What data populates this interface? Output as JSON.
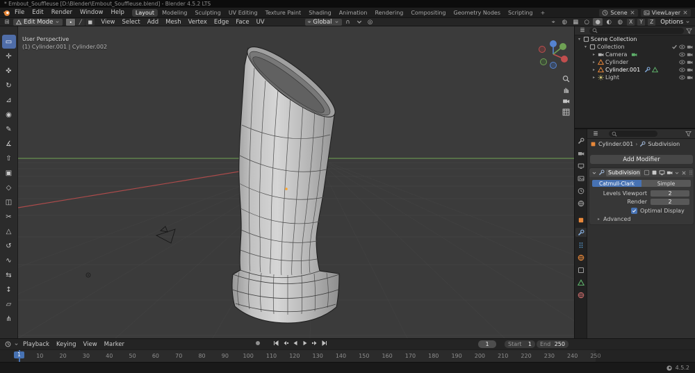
{
  "colors": {
    "accent": "#4772b3",
    "object_orange": "#e8883a",
    "data_green": "#5eb06a",
    "axis_green": "#6fa154",
    "axis_red": "#c14e4e"
  },
  "titlebar": {
    "title": "* Embout_Souffleuse [D:\\Blender\\Embout_Souffleuse.blend] - Blender 4.5.2 LTS"
  },
  "topbar": {
    "menus": [
      "File",
      "Edit",
      "Render",
      "Window",
      "Help"
    ],
    "workspaces": [
      "Layout",
      "Modeling",
      "Sculpting",
      "UV Editing",
      "Texture Paint",
      "Shading",
      "Animation",
      "Rendering",
      "Compositing",
      "Geometry Nodes",
      "Scripting"
    ],
    "add_workspace": "+",
    "scene": "Scene",
    "viewlayer": "ViewLayer"
  },
  "tool_header": {
    "mode": "Edit Mode",
    "menus": [
      "View",
      "Select",
      "Add",
      "Mesh",
      "Vertex",
      "Edge",
      "Face",
      "UV"
    ],
    "orientation": "Global",
    "mirror_axes": [
      "X",
      "Y",
      "Z"
    ],
    "options": "Options"
  },
  "toolbar": {
    "tools": [
      {
        "name": "select-box",
        "glyph": "▭"
      },
      {
        "name": "cursor",
        "glyph": "✛"
      },
      {
        "name": "move",
        "glyph": "✜"
      },
      {
        "name": "rotate",
        "glyph": "↻"
      },
      {
        "name": "scale",
        "glyph": "⊿"
      },
      {
        "name": "transform",
        "glyph": "◉"
      },
      {
        "name": "annotate",
        "glyph": "✎"
      },
      {
        "name": "measure",
        "glyph": "∡"
      },
      {
        "name": "extrude-region",
        "glyph": "⇧"
      },
      {
        "name": "inset-faces",
        "glyph": "▣"
      },
      {
        "name": "bevel",
        "glyph": "◇"
      },
      {
        "name": "loop-cut",
        "glyph": "◫"
      },
      {
        "name": "knife",
        "glyph": "✂"
      },
      {
        "name": "poly-build",
        "glyph": "△"
      },
      {
        "name": "spin",
        "glyph": "↺"
      },
      {
        "name": "smooth",
        "glyph": "∿"
      },
      {
        "name": "edge-slide",
        "glyph": "⇆"
      },
      {
        "name": "shrink-flatten",
        "glyph": "↕"
      },
      {
        "name": "shear",
        "glyph": "▱"
      },
      {
        "name": "rip-region",
        "glyph": "⋔"
      }
    ]
  },
  "viewport": {
    "overlay_line1": "User Perspective",
    "overlay_line2": "(1) Cylinder.001 | Cylinder.002"
  },
  "outliner": {
    "rows": [
      {
        "label": "Scene Collection"
      },
      {
        "label": "Collection"
      },
      {
        "label": "Camera"
      },
      {
        "label": "Cylinder"
      },
      {
        "label": "Cylinder.001"
      },
      {
        "label": "Light"
      }
    ]
  },
  "properties": {
    "breadcrumb_object": "Cylinder.001",
    "breadcrumb_modifier": "Subdivision",
    "add_modifier_label": "Add Modifier",
    "modifier": {
      "name": "Subdivision",
      "type_options": [
        "Catmull-Clark",
        "Simple"
      ],
      "active_type": "Catmull-Clark",
      "levels_viewport_label": "Levels Viewport",
      "levels_viewport_value": "2",
      "render_label": "Render",
      "render_value": "2",
      "optimal_display_label": "Optimal Display",
      "optimal_display_checked": true,
      "advanced_label": "Advanced"
    }
  },
  "timeline": {
    "menus": [
      "Playback",
      "Keying",
      "View",
      "Marker"
    ],
    "current_frame": "1",
    "start_label": "Start",
    "start_value": "1",
    "end_label": "End",
    "end_value": "250",
    "playhead_frame": "1",
    "ruler_ticks": [
      10,
      20,
      30,
      40,
      50,
      60,
      70,
      80,
      90,
      100,
      110,
      120,
      130,
      140,
      150,
      160,
      170,
      180,
      190,
      200,
      210,
      220,
      230,
      240,
      250
    ]
  },
  "statusbar": {
    "version": "4.5.2"
  }
}
